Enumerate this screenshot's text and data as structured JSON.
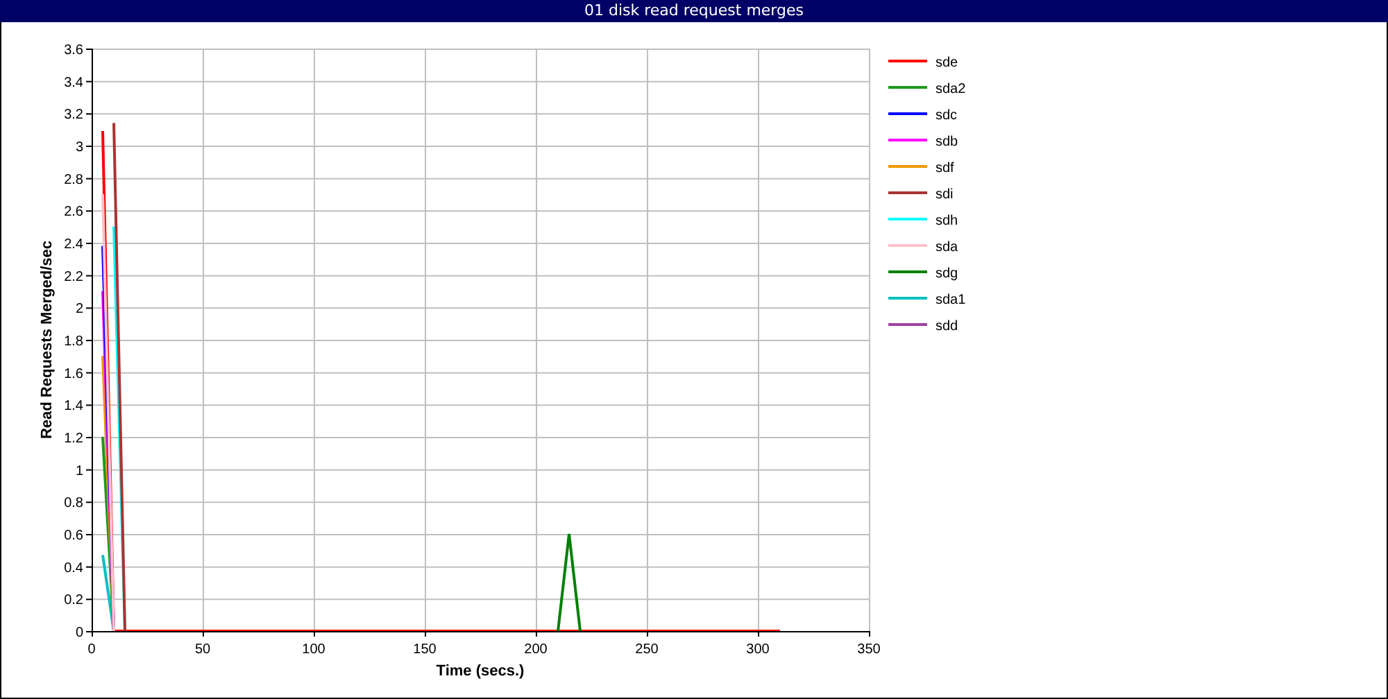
{
  "window": {
    "title": "01 disk read request merges"
  },
  "chart_data": {
    "type": "line",
    "xlabel": "Time (secs.)",
    "ylabel": "Read Requests Merged/sec",
    "x": [
      5,
      10,
      15,
      210,
      215,
      220,
      310
    ],
    "series": [
      {
        "name": "sde",
        "color": "#ff0000",
        "values": [
          3.09,
          0,
          0,
          0,
          0,
          0,
          0
        ]
      },
      {
        "name": "sda2",
        "color": "#1a9a1a",
        "values": [
          1.2,
          0,
          null,
          null,
          null,
          null,
          null
        ]
      },
      {
        "name": "sdc",
        "color": "#0000ff",
        "values": [
          2.38,
          0,
          null,
          null,
          null,
          null,
          null
        ]
      },
      {
        "name": "sdb",
        "color": "#ff00ff",
        "values": [
          2.1,
          0,
          null,
          null,
          null,
          null,
          null
        ]
      },
      {
        "name": "sdf",
        "color": "#ee9900",
        "values": [
          1.7,
          0,
          null,
          null,
          null,
          null,
          null
        ]
      },
      {
        "name": "sdi",
        "color": "#aa3333",
        "values": [
          null,
          3.14,
          0,
          null,
          null,
          null,
          null
        ]
      },
      {
        "name": "sdh",
        "color": "#00ffff",
        "values": [
          null,
          2.5,
          0,
          null,
          null,
          null,
          null
        ]
      },
      {
        "name": "sda",
        "color": "#ffc0cb",
        "values": [
          2.7,
          0,
          null,
          null,
          null,
          null,
          null
        ]
      },
      {
        "name": "sdg",
        "color": "#008000",
        "values": [
          null,
          null,
          null,
          0,
          0.6,
          0,
          null
        ]
      },
      {
        "name": "sda1",
        "color": "#00c0c0",
        "values": [
          0.47,
          0,
          null,
          null,
          null,
          null,
          null
        ]
      },
      {
        "name": "sdd",
        "color": "#a040a0",
        "values": [
          null,
          null,
          null,
          null,
          null,
          null,
          null
        ]
      }
    ],
    "grid": true,
    "legend": true,
    "xlim": [
      0,
      350
    ],
    "ylim": [
      0,
      3.6
    ],
    "xticks": [
      0,
      50,
      100,
      150,
      200,
      250,
      300,
      350
    ],
    "yticks": [
      0,
      0.2,
      0.4,
      0.6,
      0.8,
      1,
      1.2,
      1.4,
      1.6,
      1.8,
      2,
      2.2,
      2.4,
      2.6,
      2.8,
      3,
      3.2,
      3.4,
      3.6
    ]
  }
}
